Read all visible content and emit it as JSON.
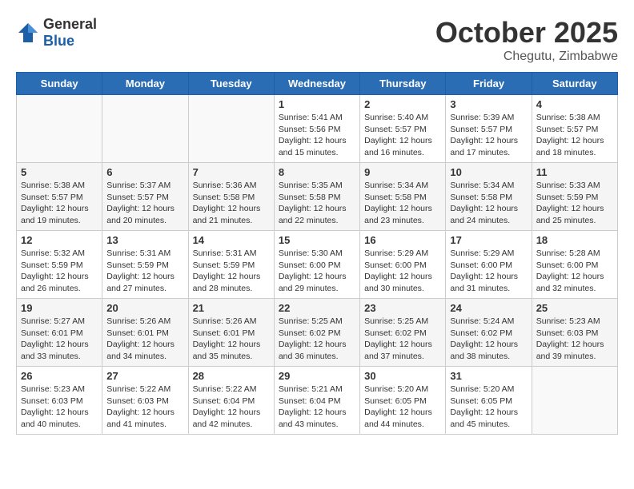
{
  "header": {
    "logo": {
      "general": "General",
      "blue": "Blue"
    },
    "month": "October 2025",
    "location": "Chegutu, Zimbabwe"
  },
  "weekdays": [
    "Sunday",
    "Monday",
    "Tuesday",
    "Wednesday",
    "Thursday",
    "Friday",
    "Saturday"
  ],
  "weeks": [
    [
      {
        "day": "",
        "info": ""
      },
      {
        "day": "",
        "info": ""
      },
      {
        "day": "",
        "info": ""
      },
      {
        "day": "1",
        "info": "Sunrise: 5:41 AM\nSunset: 5:56 PM\nDaylight: 12 hours\nand 15 minutes."
      },
      {
        "day": "2",
        "info": "Sunrise: 5:40 AM\nSunset: 5:57 PM\nDaylight: 12 hours\nand 16 minutes."
      },
      {
        "day": "3",
        "info": "Sunrise: 5:39 AM\nSunset: 5:57 PM\nDaylight: 12 hours\nand 17 minutes."
      },
      {
        "day": "4",
        "info": "Sunrise: 5:38 AM\nSunset: 5:57 PM\nDaylight: 12 hours\nand 18 minutes."
      }
    ],
    [
      {
        "day": "5",
        "info": "Sunrise: 5:38 AM\nSunset: 5:57 PM\nDaylight: 12 hours\nand 19 minutes."
      },
      {
        "day": "6",
        "info": "Sunrise: 5:37 AM\nSunset: 5:57 PM\nDaylight: 12 hours\nand 20 minutes."
      },
      {
        "day": "7",
        "info": "Sunrise: 5:36 AM\nSunset: 5:58 PM\nDaylight: 12 hours\nand 21 minutes."
      },
      {
        "day": "8",
        "info": "Sunrise: 5:35 AM\nSunset: 5:58 PM\nDaylight: 12 hours\nand 22 minutes."
      },
      {
        "day": "9",
        "info": "Sunrise: 5:34 AM\nSunset: 5:58 PM\nDaylight: 12 hours\nand 23 minutes."
      },
      {
        "day": "10",
        "info": "Sunrise: 5:34 AM\nSunset: 5:58 PM\nDaylight: 12 hours\nand 24 minutes."
      },
      {
        "day": "11",
        "info": "Sunrise: 5:33 AM\nSunset: 5:59 PM\nDaylight: 12 hours\nand 25 minutes."
      }
    ],
    [
      {
        "day": "12",
        "info": "Sunrise: 5:32 AM\nSunset: 5:59 PM\nDaylight: 12 hours\nand 26 minutes."
      },
      {
        "day": "13",
        "info": "Sunrise: 5:31 AM\nSunset: 5:59 PM\nDaylight: 12 hours\nand 27 minutes."
      },
      {
        "day": "14",
        "info": "Sunrise: 5:31 AM\nSunset: 5:59 PM\nDaylight: 12 hours\nand 28 minutes."
      },
      {
        "day": "15",
        "info": "Sunrise: 5:30 AM\nSunset: 6:00 PM\nDaylight: 12 hours\nand 29 minutes."
      },
      {
        "day": "16",
        "info": "Sunrise: 5:29 AM\nSunset: 6:00 PM\nDaylight: 12 hours\nand 30 minutes."
      },
      {
        "day": "17",
        "info": "Sunrise: 5:29 AM\nSunset: 6:00 PM\nDaylight: 12 hours\nand 31 minutes."
      },
      {
        "day": "18",
        "info": "Sunrise: 5:28 AM\nSunset: 6:00 PM\nDaylight: 12 hours\nand 32 minutes."
      }
    ],
    [
      {
        "day": "19",
        "info": "Sunrise: 5:27 AM\nSunset: 6:01 PM\nDaylight: 12 hours\nand 33 minutes."
      },
      {
        "day": "20",
        "info": "Sunrise: 5:26 AM\nSunset: 6:01 PM\nDaylight: 12 hours\nand 34 minutes."
      },
      {
        "day": "21",
        "info": "Sunrise: 5:26 AM\nSunset: 6:01 PM\nDaylight: 12 hours\nand 35 minutes."
      },
      {
        "day": "22",
        "info": "Sunrise: 5:25 AM\nSunset: 6:02 PM\nDaylight: 12 hours\nand 36 minutes."
      },
      {
        "day": "23",
        "info": "Sunrise: 5:25 AM\nSunset: 6:02 PM\nDaylight: 12 hours\nand 37 minutes."
      },
      {
        "day": "24",
        "info": "Sunrise: 5:24 AM\nSunset: 6:02 PM\nDaylight: 12 hours\nand 38 minutes."
      },
      {
        "day": "25",
        "info": "Sunrise: 5:23 AM\nSunset: 6:03 PM\nDaylight: 12 hours\nand 39 minutes."
      }
    ],
    [
      {
        "day": "26",
        "info": "Sunrise: 5:23 AM\nSunset: 6:03 PM\nDaylight: 12 hours\nand 40 minutes."
      },
      {
        "day": "27",
        "info": "Sunrise: 5:22 AM\nSunset: 6:03 PM\nDaylight: 12 hours\nand 41 minutes."
      },
      {
        "day": "28",
        "info": "Sunrise: 5:22 AM\nSunset: 6:04 PM\nDaylight: 12 hours\nand 42 minutes."
      },
      {
        "day": "29",
        "info": "Sunrise: 5:21 AM\nSunset: 6:04 PM\nDaylight: 12 hours\nand 43 minutes."
      },
      {
        "day": "30",
        "info": "Sunrise: 5:20 AM\nSunset: 6:05 PM\nDaylight: 12 hours\nand 44 minutes."
      },
      {
        "day": "31",
        "info": "Sunrise: 5:20 AM\nSunset: 6:05 PM\nDaylight: 12 hours\nand 45 minutes."
      },
      {
        "day": "",
        "info": ""
      }
    ]
  ]
}
